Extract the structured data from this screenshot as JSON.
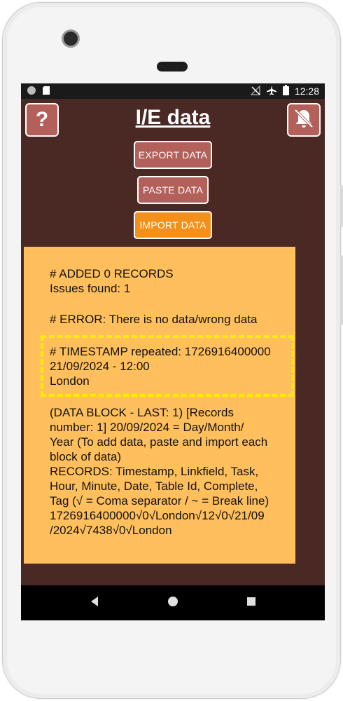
{
  "status": {
    "time": "12:28"
  },
  "app": {
    "title": "I/E data",
    "help_label": "?",
    "help_icon": "question-icon",
    "bell_icon": "bell-off-icon"
  },
  "buttons": {
    "export": "EXPORT DATA",
    "paste": "PASTE DATA",
    "import": "IMPORT DATA"
  },
  "result": {
    "line1": "# ADDED 0 RECORDS",
    "line2": "Issues found: 1",
    "line3": "# ERROR: There is no data/wrong data",
    "ts_line1": "# TIMESTAMP repeated: 1726916400000",
    "ts_line2": "21/09/2024 - 12:00",
    "ts_line3": "London",
    "block1": "(DATA BLOCK - LAST: 1) [Records",
    "block2": "number: 1] 20/09/2024 = Day/Month/",
    "block3": "Year (To add data, paste and import each",
    "block4": "block of data)",
    "block5": "RECORDS: Timestamp, Linkfield, Task,",
    "block6": "Hour, Minute, Date, Table Id, Complete,",
    "block7": "Tag (√ = Coma separator / ~ = Break line)",
    "block8": "1726916400000√0√London√12√0√21/09",
    "block9": "/2024√7438√0√London"
  },
  "colors": {
    "background": "#4a2824",
    "button": "#b35f5a",
    "import_button": "#f39019",
    "panel": "#ffbf5d",
    "highlight": "#ffee00"
  }
}
